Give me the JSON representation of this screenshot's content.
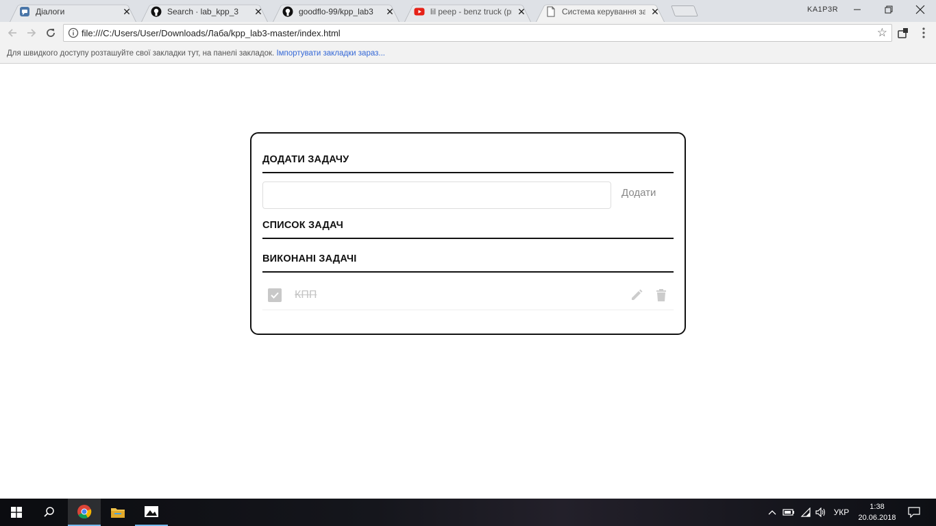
{
  "browser": {
    "tabs": [
      {
        "title": "Діалоги",
        "icon": "chat-icon",
        "color": "#4a76a8"
      },
      {
        "title": "Search · lab_kpp_3",
        "icon": "github-icon",
        "color": "#111111"
      },
      {
        "title": "goodflo-99/kpp_lab3",
        "icon": "github-icon",
        "color": "#111111"
      },
      {
        "title": "lil peep - benz truck (prod",
        "icon": "youtube-icon",
        "color": "#e62117"
      },
      {
        "title": "Система керування зада",
        "icon": "document-icon",
        "color": "#555555"
      }
    ],
    "profile_name": "KA1P3R",
    "url": "file:///C:/Users/User/Downloads/Лаба/kpp_lab3-master/index.html",
    "bookmarks_hint": "Для швидкого доступу розташуйте свої закладки тут, на панелі закладок.",
    "bookmarks_import_link": "Імпортувати закладки зараз..."
  },
  "app": {
    "add_section_title": "ДОДАТИ ЗАДАЧУ",
    "task_input_value": "",
    "add_button_label": "Додати",
    "todo_section_title": "СПИСОК ЗАДАЧ",
    "todo_items": [],
    "done_section_title": "ВИКОНАНІ ЗАДАЧІ",
    "done_items": [
      {
        "label": "КПП",
        "checked": true
      }
    ],
    "colors": {
      "border": "#111111",
      "muted_text": "#c4c4c4",
      "icon": "#cccccc"
    }
  },
  "taskbar": {
    "language": "УКР",
    "time": "1:38",
    "date": "20.06.2018",
    "accent": "#76b9ed"
  }
}
